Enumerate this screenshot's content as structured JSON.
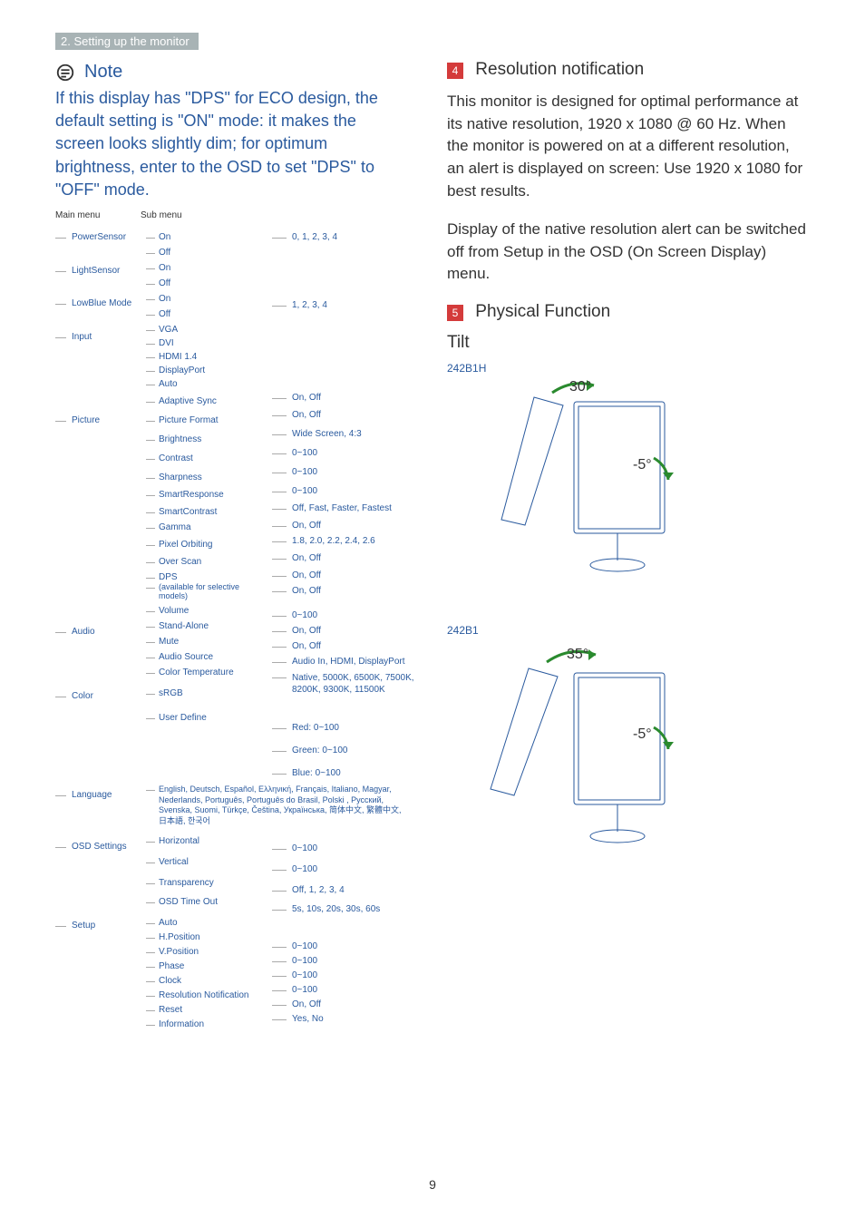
{
  "section_bar": "2. Setting up the monitor",
  "note": {
    "title": "Note",
    "body": "If this display has \"DPS\" for ECO design, the default setting is \"ON\" mode: it makes the screen looks slightly dim; for optimum brightness, enter to the OSD to set \"DPS\" to \"OFF\" mode."
  },
  "menu_headers": {
    "main": "Main menu",
    "sub": "Sub menu"
  },
  "menu": {
    "PowerSensor": {
      "sub": [
        "On",
        "Off"
      ],
      "vals": [
        "0, 1, 2, 3, 4"
      ]
    },
    "LightSensor": {
      "sub": [
        "On",
        "Off"
      ],
      "vals": []
    },
    "LowBlue_Mode": {
      "label": "LowBlue Mode",
      "sub": [
        "On",
        "Off"
      ],
      "vals": [
        "1, 2, 3, 4"
      ]
    },
    "Input": {
      "sub": [
        "VGA",
        "DVI",
        "HDMI 1.4",
        "DisplayPort",
        "Auto"
      ],
      "vals": [
        "",
        "",
        "",
        "",
        "On, Off"
      ]
    },
    "Picture": {
      "sub": [
        "Adaptive Sync",
        "Picture Format",
        "Brightness",
        "Contrast",
        "Sharpness",
        "SmartResponse",
        "SmartContrast",
        "Gamma",
        "Pixel Orbiting",
        "Over Scan",
        "DPS"
      ],
      "dps_note": "(available for selective models)",
      "vals": [
        "On, Off",
        "Wide Screen, 4:3",
        "0~100",
        "0~100",
        "0~100",
        "Off, Fast, Faster, Fastest",
        "On, Off",
        "1.8, 2.0, 2.2, 2.4, 2.6",
        "On, Off",
        "On, Off",
        "On, Off"
      ]
    },
    "Audio": {
      "sub": [
        "Volume",
        "Stand-Alone",
        "Mute",
        "Audio Source"
      ],
      "vals": [
        "0~100",
        "On, Off",
        "On, Off",
        "Audio In, HDMI, DisplayPort"
      ]
    },
    "Color": {
      "sub": [
        "Color Temperature",
        "sRGB",
        "User Define"
      ],
      "vals": [
        "Native, 5000K, 6500K, 7500K, 8200K, 9300K, 11500K"
      ],
      "user_define": [
        "Red: 0~100",
        "Green: 0~100",
        "Blue: 0~100"
      ]
    },
    "Language": {
      "langs": "English, Deutsch, Español, Ελληνική, Français, Italiano, Magyar, Nederlands, Português, Português do Brasil, Polski , Русский, Svenska, Suomi, Türkçe, Čeština, Українська, 简体中文, 繁體中文,日本語, 한국어"
    },
    "OSD_Settings": {
      "label": "OSD Settings",
      "sub": [
        "Horizontal",
        "Vertical",
        "Transparency",
        "OSD Time Out"
      ],
      "vals": [
        "0~100",
        "0~100",
        "Off, 1, 2, 3, 4",
        "5s, 10s, 20s, 30s, 60s"
      ]
    },
    "Setup": {
      "sub": [
        "Auto",
        "H.Position",
        "V.Position",
        "Phase",
        "Clock",
        "Resolution Notification",
        "Reset",
        "Information"
      ],
      "vals": [
        "",
        "0~100",
        "0~100",
        "0~100",
        "0~100",
        "On, Off",
        "Yes, No",
        ""
      ]
    }
  },
  "step4": {
    "badge": "4",
    "title": "Resolution notification",
    "p1": "This monitor is designed for optimal performance at its native resolution, 1920 x 1080 @ 60 Hz. When the monitor is powered on at a different resolution, an alert is displayed on screen: Use 1920 x 1080 for best results.",
    "p2": "Display of the native resolution alert can be switched off from Setup in the OSD (On Screen Display) menu."
  },
  "step5": {
    "badge": "5",
    "title": "Physical Function",
    "sub": "Tilt"
  },
  "tilt": [
    {
      "model": "242B1H",
      "angle_fwd": "30°",
      "angle_back": "-5°"
    },
    {
      "model": "242B1",
      "angle_fwd": "35°",
      "angle_back": "-5°"
    }
  ],
  "page_number": "9"
}
